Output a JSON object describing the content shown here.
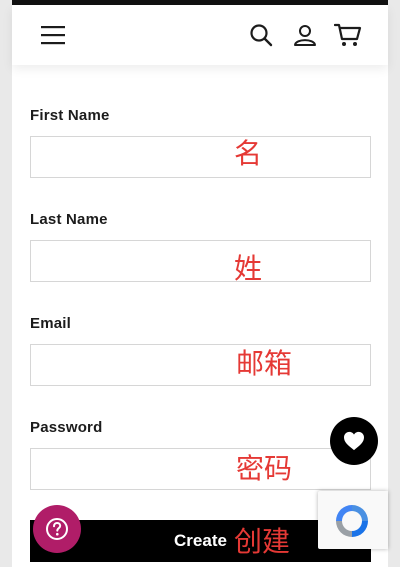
{
  "header": {
    "menu_icon": "hamburger-menu-icon",
    "search_icon": "search-icon",
    "account_icon": "user-icon",
    "cart_icon": "cart-icon"
  },
  "form": {
    "fields": [
      {
        "label": "First Name",
        "value": "",
        "annotation": "名"
      },
      {
        "label": "Last Name",
        "value": "",
        "annotation": "姓"
      },
      {
        "label": "Email",
        "value": "",
        "annotation": "邮箱"
      },
      {
        "label": "Password",
        "value": "",
        "annotation": "密码"
      }
    ],
    "submit_label": "Create",
    "submit_annotation": "创建"
  },
  "widgets": {
    "wishlist_icon": "heart-icon",
    "help_icon": "question-mark-icon",
    "recaptcha_icon": "recaptcha-logo-icon"
  },
  "colors": {
    "annotation": "#e53935",
    "button_bg": "#000000",
    "help_fab_bg": "#b01d68"
  }
}
